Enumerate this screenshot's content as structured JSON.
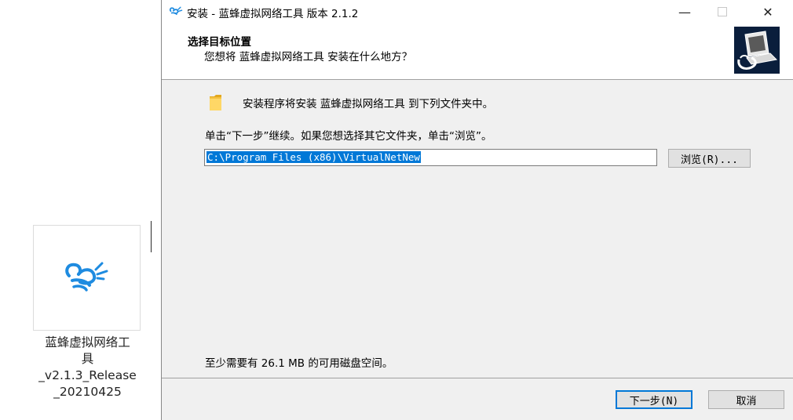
{
  "desktop_file": {
    "name_lines": [
      "蓝蜂虚拟网络工",
      "具",
      "_v2.1.3_Release",
      "_20210425"
    ],
    "icon": "bee-logo-icon"
  },
  "window": {
    "title": "安装 - 蓝蜂虚拟网络工具 版本 2.1.2",
    "title_icon": "bee-logo-icon",
    "controls": {
      "minimize": "—",
      "close": "✕"
    }
  },
  "header": {
    "title": "选择目标位置",
    "subtitle": "您想将 蓝蜂虚拟网络工具 安装在什么地方？",
    "logo": "installer-computer-icon"
  },
  "body": {
    "intro": "安装程序将安装 蓝蜂虚拟网络工具 到下列文件夹中。",
    "prompt": "单击“下一步”继续。如果您想选择其它文件夹，单击“浏览”。",
    "install_path": "C:\\Program Files (x86)\\VirtualNetNew",
    "browse_label": "浏览(R)...",
    "disk_space": "至少需要有 26.1 MB 的可用磁盘空间。"
  },
  "footer": {
    "next_label": "下一步(N)",
    "cancel_label": "取消"
  },
  "colors": {
    "accent": "#0078d7",
    "bee_blue": "#1e8be0",
    "folder_yellow": "#f5c242"
  }
}
